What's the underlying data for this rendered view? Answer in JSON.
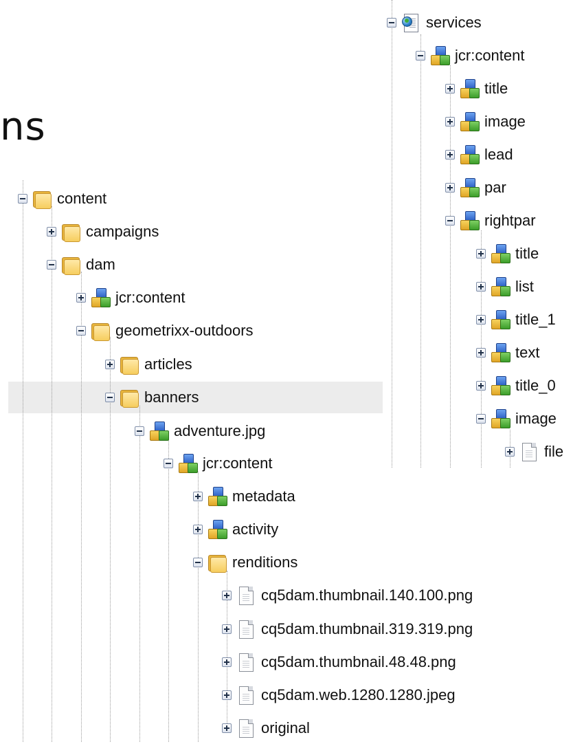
{
  "heading_fragment": "ns",
  "left_tree": [
    {
      "label": "content",
      "icon": "folder-icon",
      "state": "expanded"
    },
    {
      "label": "campaigns",
      "icon": "folder-icon",
      "state": "collapsed"
    },
    {
      "label": "dam",
      "icon": "folder-icon",
      "state": "expanded"
    },
    {
      "label": "jcr:content",
      "icon": "node-icon",
      "state": "collapsed"
    },
    {
      "label": "geometrixx-outdoors",
      "icon": "folder-icon",
      "state": "expanded"
    },
    {
      "label": "articles",
      "icon": "folder-icon",
      "state": "collapsed"
    },
    {
      "label": "banners",
      "icon": "folder-icon",
      "state": "expanded",
      "selected": true
    },
    {
      "label": "adventure.jpg",
      "icon": "node-icon",
      "state": "expanded"
    },
    {
      "label": "jcr:content",
      "icon": "node-icon",
      "state": "expanded"
    },
    {
      "label": "metadata",
      "icon": "node-icon",
      "state": "collapsed"
    },
    {
      "label": "activity",
      "icon": "node-icon",
      "state": "collapsed"
    },
    {
      "label": "renditions",
      "icon": "folder-icon",
      "state": "expanded"
    },
    {
      "label": "cq5dam.thumbnail.140.100.png",
      "icon": "file-icon",
      "state": "collapsed"
    },
    {
      "label": "cq5dam.thumbnail.319.319.png",
      "icon": "file-icon",
      "state": "collapsed"
    },
    {
      "label": "cq5dam.thumbnail.48.48.png",
      "icon": "file-icon",
      "state": "collapsed"
    },
    {
      "label": "cq5dam.web.1280.1280.jpeg",
      "icon": "file-icon",
      "state": "collapsed"
    },
    {
      "label": "original",
      "icon": "file-icon",
      "state": "collapsed"
    }
  ],
  "right_tree": [
    {
      "label": "services",
      "icon": "page-icon",
      "state": "expanded"
    },
    {
      "label": "jcr:content",
      "icon": "node-icon",
      "state": "expanded"
    },
    {
      "label": "title",
      "icon": "node-icon",
      "state": "collapsed"
    },
    {
      "label": "image",
      "icon": "node-icon",
      "state": "collapsed"
    },
    {
      "label": "lead",
      "icon": "node-icon",
      "state": "collapsed"
    },
    {
      "label": "par",
      "icon": "node-icon",
      "state": "collapsed"
    },
    {
      "label": "rightpar",
      "icon": "node-icon",
      "state": "expanded"
    },
    {
      "label": "title",
      "icon": "node-icon",
      "state": "collapsed"
    },
    {
      "label": "list",
      "icon": "node-icon",
      "state": "collapsed"
    },
    {
      "label": "title_1",
      "icon": "node-icon",
      "state": "collapsed"
    },
    {
      "label": "text",
      "icon": "node-icon",
      "state": "collapsed"
    },
    {
      "label": "title_0",
      "icon": "node-icon",
      "state": "collapsed"
    },
    {
      "label": "image",
      "icon": "node-icon",
      "state": "expanded"
    },
    {
      "label": "file",
      "icon": "file-icon",
      "state": "collapsed"
    }
  ]
}
